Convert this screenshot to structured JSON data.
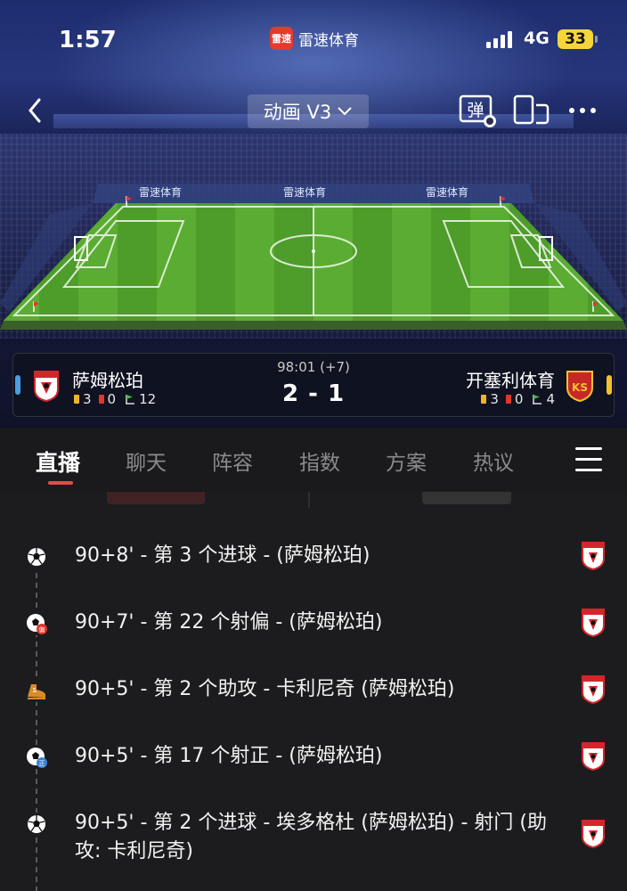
{
  "status_bar": {
    "time": "1:57",
    "app_name": "雷速体育",
    "app_logo_text": "雷速",
    "network": "4G",
    "battery": "33"
  },
  "toolbar": {
    "mode_label": "动画 V3",
    "danmu_label": "弹"
  },
  "pitch": {
    "sponsor_text": "雷速体育"
  },
  "match": {
    "time": "98:01 (+7)",
    "score": "2 - 1",
    "home": {
      "name": "萨姆松珀",
      "yellow_cards": "3",
      "red_cards": "0",
      "corners": "12",
      "color": "#4a9de0"
    },
    "away": {
      "name": "开塞利体育",
      "badge_text": "KS",
      "yellow_cards": "3",
      "red_cards": "0",
      "corners": "4",
      "color": "#f2c230"
    }
  },
  "tabs": [
    {
      "label": "直播",
      "active": true
    },
    {
      "label": "聊天"
    },
    {
      "label": "阵容"
    },
    {
      "label": "指数"
    },
    {
      "label": "方案"
    },
    {
      "label": "热议"
    }
  ],
  "events": [
    {
      "text": "90+8' - 第 3 个进球 - (萨姆松珀)",
      "icon": "goal-icon"
    },
    {
      "text": "90+7' - 第 22 个射偏 - (萨姆松珀)",
      "icon": "shot-off-target-icon"
    },
    {
      "text": "90+5' - 第 2 个助攻 - 卡利尼奇 (萨姆松珀)",
      "icon": "assist-boot-icon"
    },
    {
      "text": "90+5' - 第 17 个射正 - (萨姆松珀)",
      "icon": "shot-on-target-icon"
    },
    {
      "text": "90+5' - 第 2 个进球 - 埃多格杜 (萨姆松珀) - 射门 (助攻: 卡利尼奇)",
      "icon": "goal-icon"
    }
  ],
  "colors": {
    "accent_red": "#e24b4b",
    "background": "#1c1c1e",
    "pitch_green": "#4fa02a"
  }
}
